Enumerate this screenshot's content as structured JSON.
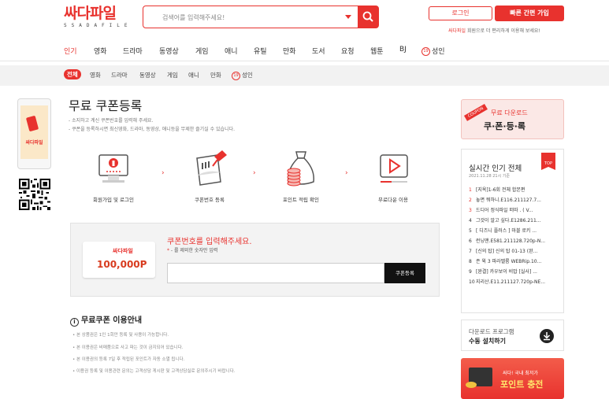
{
  "header": {
    "logo_main": "싸다파일",
    "logo_sub": "SSADAFILE",
    "search_placeholder": "검색어를 입력해주세요!",
    "login_label": "로그인",
    "join_label": "빠른 간편 가입",
    "promo_highlight": "싸다파일",
    "promo_rest": " 회원으로 더 편리하게 이용해 보세요!"
  },
  "nav": {
    "items": [
      "인기",
      "영화",
      "드라마",
      "동영상",
      "게임",
      "애니",
      "유틸",
      "만화",
      "도서",
      "요청",
      "웹툰",
      "BJ",
      "성인"
    ],
    "badge": "19"
  },
  "subnav": {
    "items": [
      "전체",
      "영화",
      "드라마",
      "동영상",
      "게임",
      "애니",
      "만화",
      "성인"
    ],
    "badge": "19"
  },
  "left": {
    "phone_brand": "싸다파일"
  },
  "main": {
    "title": "무료 쿠폰등록",
    "desc1": "- 소지하고 계신 쿠폰번호를 입력해 주세요.",
    "desc2": "- 쿠폰을 등록하시면 최신영화, 드라마, 동영상, 애니등을 무제한 즐기실 수 있습니다.",
    "steps": [
      "회원가입 및 로그인",
      "쿠폰번호 등록",
      "포인트 적립 확인",
      "무료다운 이용"
    ],
    "arrow": "›",
    "ticket_brand": "싸다파일",
    "ticket_amount": "100,000P",
    "coupon_title": "쿠폰번호를 입력해주세요.",
    "coupon_note_star": "*",
    "coupon_note": " - 를 제외한 숫자만 입력",
    "coupon_button": "쿠폰등록",
    "guide_title": "무료쿠폰 이용안내",
    "guide_items": [
      "• 본 상품권은 1인 1회만 등록 및 사용이 가능합니다.",
      "• 본 이용권은 비매품으로 사고 파는 것이 금지되어 있습니다.",
      "• 본 이용권의 등록 7일 후 적립된 포인트가 자동 소멸 됩니다.",
      "• 이용권 등록 및 이용관련 문의는 고객상담 게시판 및 고객상담실로 문의주시기 바랍니다."
    ]
  },
  "sidebar": {
    "coupon_tag": "COUPON",
    "coupon_t1": "무료 다운로드",
    "coupon_t2": "쿠·폰·등·록",
    "rank_title": "실시간 인기 전체",
    "rank_date": "2021.11.28 21시 기준",
    "rank_badge": "TOP",
    "rank_items": [
      "[지옥]1-6회 전체 합본편",
      "놓면 뭐하니.E116.211127.7...",
      "드디어 정식파일 떠따 . ( V...",
      "그것이 알고 싶다.E1286.211...",
      "[ 디즈니 플러스 ] 마블 로키 ...",
      "런닝맨.E581.211128.720p-N...",
      "[신의 탑] 신의 탑 01-13 (완...",
      "존 윅 3 파라벨룸 WEBRip.10...",
      "[완결] 카우보이 비밥 [실사] ...",
      "지리산.E11.211127.720p-NE..."
    ],
    "download_a": "다운로드 프로그램",
    "download_b": "수동 설치하기",
    "point_t1": "싸다! 국내 최저가",
    "point_t2": "포인트 충전"
  },
  "colors": {
    "accent": "#e8322e"
  }
}
